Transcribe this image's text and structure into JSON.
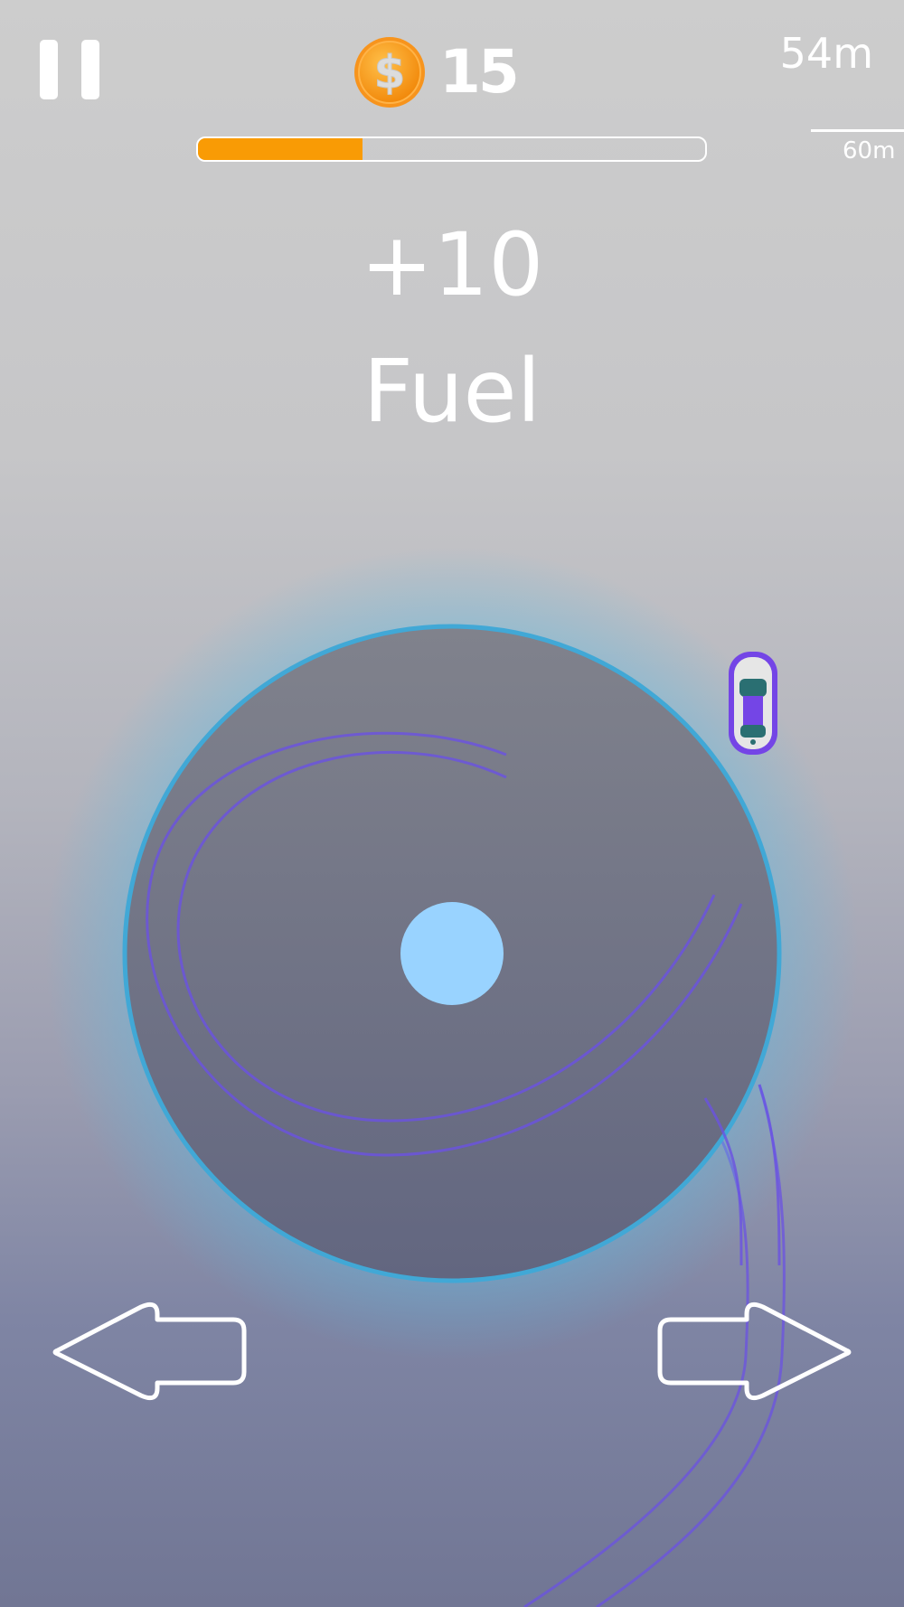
{
  "hud": {
    "coins": "15",
    "coin_symbol": "$",
    "distance": "54m",
    "target_distance": "60m",
    "fuel_progress": 0.325
  },
  "popup": {
    "amount": "+10",
    "label": "Fuel"
  },
  "colors": {
    "fuel_bar": "#f99b05",
    "coin": "#f7941d",
    "platform_ring": "#41a8d6",
    "platform_core": "#99d3ff",
    "car_body": "#7445e6",
    "car_glass": "#2a6f72",
    "tire_marks": "#6b52e3"
  },
  "icons": {
    "pause": "pause-icon",
    "coin": "coin-icon",
    "left": "arrow-left-icon",
    "right": "arrow-right-icon",
    "car": "player-car"
  }
}
